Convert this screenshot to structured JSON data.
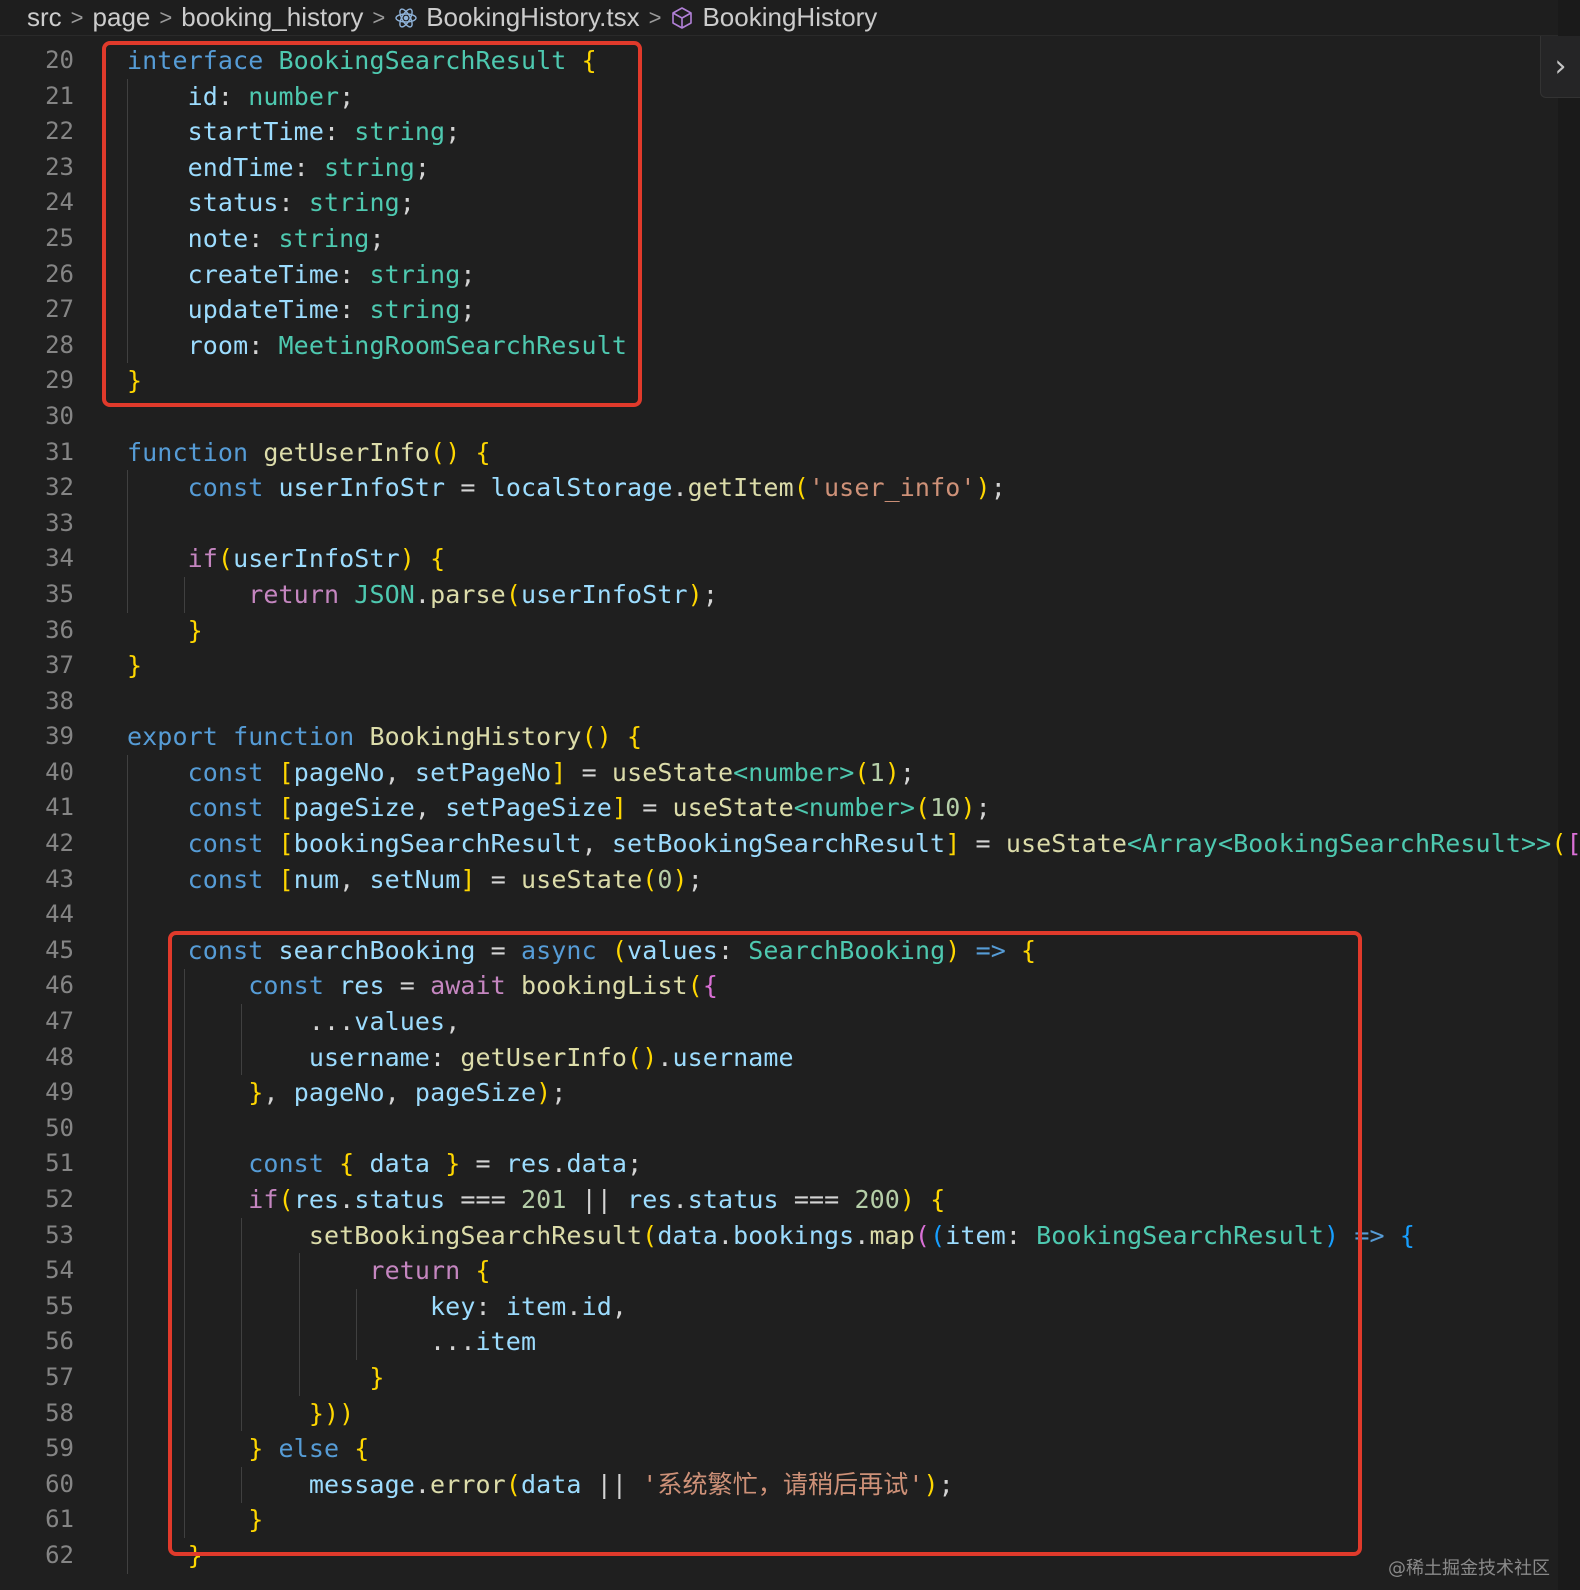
{
  "breadcrumb": {
    "items": [
      "src",
      "page",
      "booking_history",
      "BookingHistory.tsx",
      "BookingHistory"
    ],
    "file_icon": "react-atom-icon",
    "symbol_icon": "cube-icon"
  },
  "panel_toggle": {
    "icon": "chevron-right-icon",
    "glyph": "›"
  },
  "watermark": "@稀土掘金技术社区",
  "colors": {
    "highlight_box": "#e03a2b",
    "background": "#1f1f1f"
  },
  "editor": {
    "lines": [
      {
        "n": "20",
        "t": "interface BookingSearchResult {"
      },
      {
        "n": "21",
        "t": "    id: number;"
      },
      {
        "n": "22",
        "t": "    startTime: string;"
      },
      {
        "n": "23",
        "t": "    endTime: string;"
      },
      {
        "n": "24",
        "t": "    status: string;"
      },
      {
        "n": "25",
        "t": "    note: string;"
      },
      {
        "n": "26",
        "t": "    createTime: string;"
      },
      {
        "n": "27",
        "t": "    updateTime: string;"
      },
      {
        "n": "28",
        "t": "    room: MeetingRoomSearchResult"
      },
      {
        "n": "29",
        "t": "}"
      },
      {
        "n": "30",
        "t": ""
      },
      {
        "n": "31",
        "t": "function getUserInfo() {"
      },
      {
        "n": "32",
        "t": "    const userInfoStr = localStorage.getItem('user_info');"
      },
      {
        "n": "33",
        "t": ""
      },
      {
        "n": "34",
        "t": "    if(userInfoStr) {"
      },
      {
        "n": "35",
        "t": "        return JSON.parse(userInfoStr);"
      },
      {
        "n": "36",
        "t": "    }"
      },
      {
        "n": "37",
        "t": "}"
      },
      {
        "n": "38",
        "t": ""
      },
      {
        "n": "39",
        "t": "export function BookingHistory() {"
      },
      {
        "n": "40",
        "t": "    const [pageNo, setPageNo] = useState<number>(1);"
      },
      {
        "n": "41",
        "t": "    const [pageSize, setPageSize] = useState<number>(10);"
      },
      {
        "n": "42",
        "t": "    const [bookingSearchResult, setBookingSearchResult] = useState<Array<BookingSearchResult>>([]);"
      },
      {
        "n": "43",
        "t": "    const [num, setNum] = useState(0);"
      },
      {
        "n": "44",
        "t": ""
      },
      {
        "n": "45",
        "t": "    const searchBooking = async (values: SearchBooking) => {"
      },
      {
        "n": "46",
        "t": "        const res = await bookingList({"
      },
      {
        "n": "47",
        "t": "            ...values,"
      },
      {
        "n": "48",
        "t": "            username: getUserInfo().username"
      },
      {
        "n": "49",
        "t": "        }, pageNo, pageSize);"
      },
      {
        "n": "50",
        "t": ""
      },
      {
        "n": "51",
        "t": "        const { data } = res.data;"
      },
      {
        "n": "52",
        "t": "        if(res.status === 201 || res.status === 200) {"
      },
      {
        "n": "53",
        "t": "            setBookingSearchResult(data.bookings.map((item: BookingSearchResult) => {"
      },
      {
        "n": "54",
        "t": "                return {"
      },
      {
        "n": "55",
        "t": "                    key: item.id,"
      },
      {
        "n": "56",
        "t": "                    ...item"
      },
      {
        "n": "57",
        "t": "                }"
      },
      {
        "n": "58",
        "t": "            }))"
      },
      {
        "n": "59",
        "t": "        } else {"
      },
      {
        "n": "60",
        "t": "            message.error(data || '系统繁忙，请稍后再试');"
      },
      {
        "n": "61",
        "t": "        }"
      },
      {
        "n": "62",
        "t": "    }"
      }
    ]
  }
}
